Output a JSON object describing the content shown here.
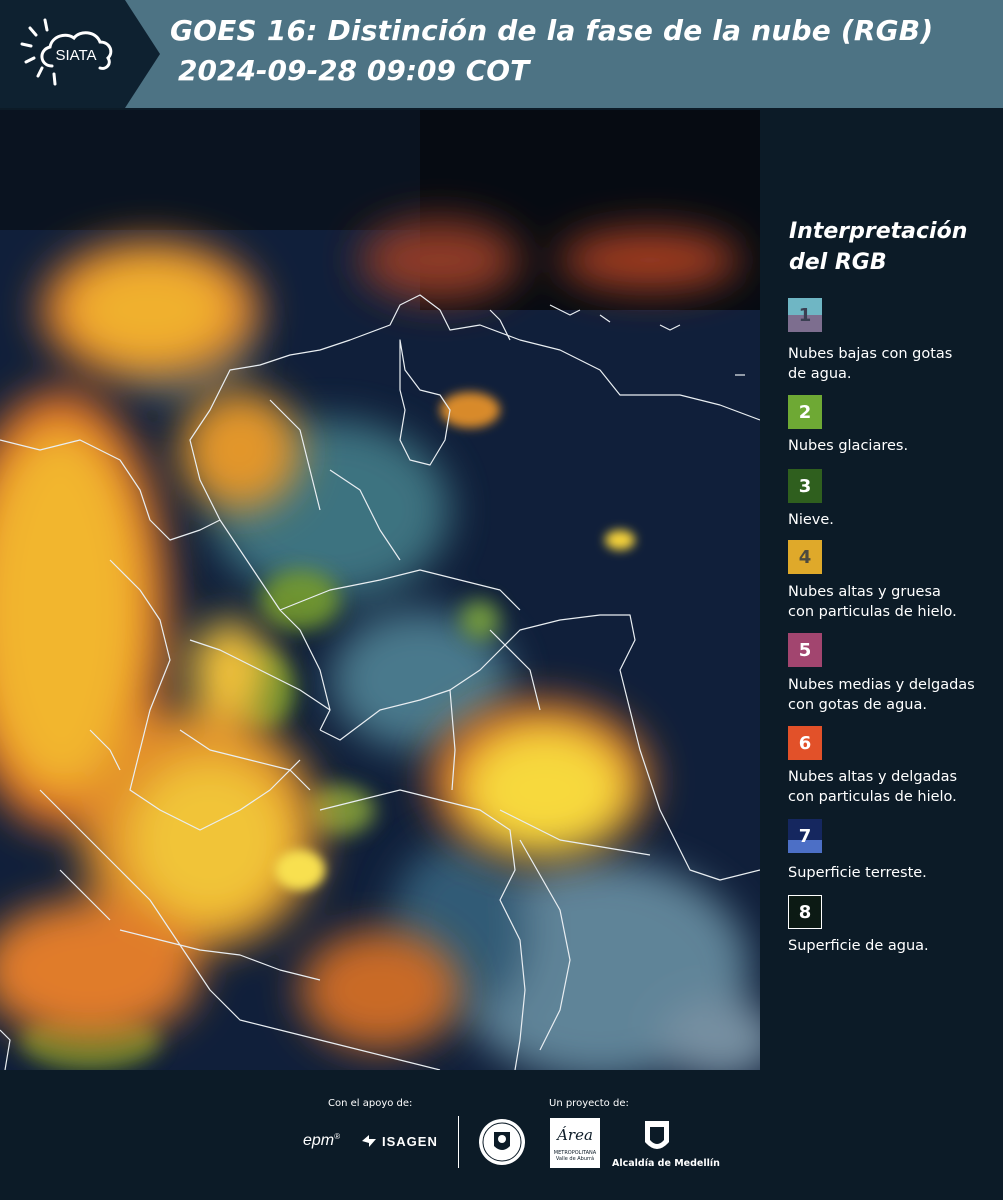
{
  "header": {
    "title_line1": "GOES 16: Distinción de la fase de la nube (RGB)",
    "title_line2": "2024-09-28 09:09 COT",
    "logo_text": "SIATA"
  },
  "legend": {
    "title_line1": "Interpretación",
    "title_line2": "del RGB",
    "items": [
      {
        "number": "1",
        "label_line1": "Nubes bajas con gotas",
        "label_line2": "de agua.",
        "color_top": "#6fb6c4",
        "color_bottom": "#7d6e8f"
      },
      {
        "number": "2",
        "label_line1": "Nubes glaciares.",
        "label_line2": "",
        "color_top": "#6ea934",
        "color_bottom": "#6ea934"
      },
      {
        "number": "3",
        "label_line1": "Nieve.",
        "label_line2": "",
        "color_top": "#2f5f1e",
        "color_bottom": "#2f5f1e"
      },
      {
        "number": "4",
        "label_line1": "Nubes altas y gruesa",
        "label_line2": "con particulas de hielo.",
        "color_top": "#dfa92a",
        "color_bottom": "#dfa92a"
      },
      {
        "number": "5",
        "label_line1": "Nubes medias y delgadas",
        "label_line2": "con gotas de agua.",
        "color_top": "#a2456f",
        "color_bottom": "#a2456f"
      },
      {
        "number": "6",
        "label_line1": "Nubes altas y delgadas",
        "label_line2": "con particulas de hielo.",
        "color_top": "#e25129",
        "color_bottom": "#e25129"
      },
      {
        "number": "7",
        "label_line1": "Superficie terreste.",
        "label_line2": "",
        "color_top": "#15275f",
        "color_bottom": "#4c6fc6"
      },
      {
        "number": "8",
        "label_line1": "Superficie de agua.",
        "label_line2": "",
        "color_top": "#0c1a14",
        "color_bottom": "#0c1a14"
      }
    ]
  },
  "footer": {
    "support_label": "Con el apoyo de:",
    "project_label": "Un proyecto de:",
    "epm": "epm",
    "isagen": "ISAGEN",
    "area_name": "Área",
    "area_sub1": "METROPOLITANA",
    "area_sub2": "Valle de Aburrá",
    "alcaldia": "Alcaldía de Medellín"
  }
}
